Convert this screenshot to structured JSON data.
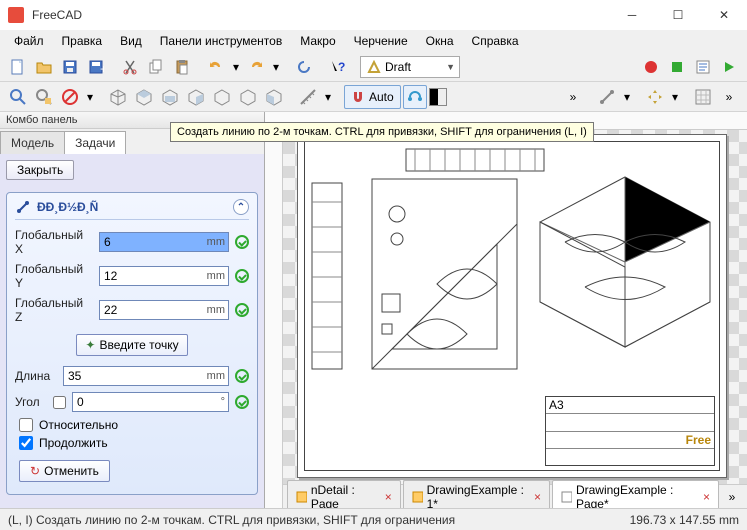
{
  "app": {
    "title": "FreeCAD"
  },
  "menu": [
    "Файл",
    "Правка",
    "Вид",
    "Панели инструментов",
    "Макро",
    "Черчение",
    "Окна",
    "Справка"
  ],
  "workspace": {
    "label": "Draft"
  },
  "auto_button": "Auto",
  "combo": {
    "title": "Комбо панель",
    "tabs": {
      "model": "Модель",
      "tasks": "Задачи"
    },
    "close": "Закрыть",
    "point_header": "ÐÐ¸Ð½Ð¸Ñ",
    "labels": {
      "gx": "Глобальный X",
      "gy": "Глобальный Y",
      "gz": "Глобальный Z",
      "length": "Длина",
      "angle": "Угол"
    },
    "values": {
      "gx": "6",
      "gy": "12",
      "gz": "22",
      "length": "35",
      "angle": "0"
    },
    "units": {
      "mm": "mm",
      "deg": "°"
    },
    "enter_point": "Введите точку",
    "relative": "Относительно",
    "continue": "Продолжить",
    "cancel": "Отменить"
  },
  "tooltip": "Создать линию по 2-м точкам. CTRL для привязки, SHIFT для ограничения (L, I)",
  "titleblock": {
    "format": "A3",
    "brand": "Free"
  },
  "doc_tabs": {
    "t1": "nDetail : Page",
    "t2": "DrawingExample : 1*",
    "t3": "DrawingExample : Page*"
  },
  "status": {
    "left": "(L, I) Создать линию по 2-м точкам. CTRL для привязки, SHIFT для ограничения",
    "right": "196.73 x 147.55 mm"
  }
}
